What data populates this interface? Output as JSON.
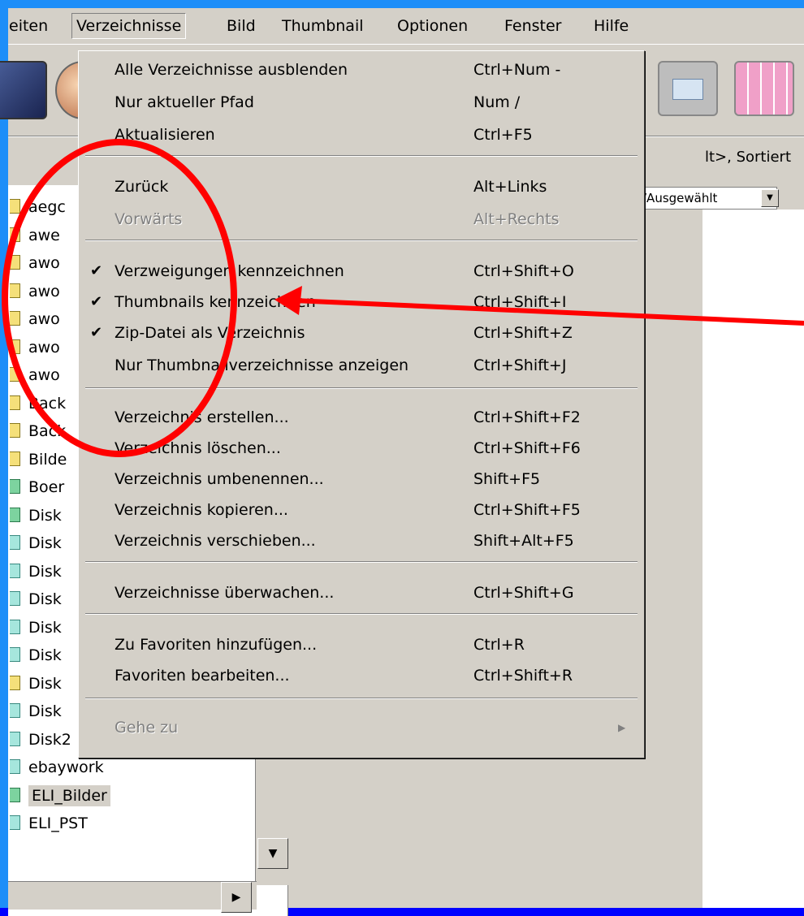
{
  "menubar": {
    "items": [
      "eiten",
      "Verzeichnisse",
      "Bild",
      "Thumbnail",
      "Optionen",
      "Fenster",
      "Hilfe"
    ]
  },
  "infobar": {
    "text": "lt>, Sortiert"
  },
  "combo": {
    "value": "/Ausgewählt"
  },
  "tree": {
    "items": [
      {
        "label": "aegc",
        "color": "yellow"
      },
      {
        "label": "awe",
        "color": "yellow"
      },
      {
        "label": "awo",
        "color": "yellow"
      },
      {
        "label": "awo",
        "color": "yellow"
      },
      {
        "label": "awo",
        "color": "yellow"
      },
      {
        "label": "awo",
        "color": "yellow"
      },
      {
        "label": "awo",
        "color": "yellow"
      },
      {
        "label": "Back",
        "color": "yellow"
      },
      {
        "label": "Back",
        "color": "yellow"
      },
      {
        "label": "Bilde",
        "color": "yellow"
      },
      {
        "label": "Boer",
        "color": "green"
      },
      {
        "label": "Disk",
        "color": "green"
      },
      {
        "label": "Disk",
        "color": "teal"
      },
      {
        "label": "Disk",
        "color": "teal"
      },
      {
        "label": "Disk",
        "color": "teal"
      },
      {
        "label": "Disk",
        "color": "teal"
      },
      {
        "label": "Disk",
        "color": "teal"
      },
      {
        "label": "Disk",
        "color": "yellow"
      },
      {
        "label": "Disk",
        "color": "teal"
      },
      {
        "label": "Disk2",
        "color": "teal"
      },
      {
        "label": "ebaywork",
        "color": "teal"
      },
      {
        "label": "ELI_Bilder",
        "color": "green"
      },
      {
        "label": "ELI_PST",
        "color": "teal"
      }
    ]
  },
  "menu": {
    "items": [
      {
        "label": "Alle Verzeichnisse ausblenden",
        "shortcut": "Ctrl+Num -",
        "checked": "",
        "disabled": false
      },
      {
        "label": "Nur aktueller Pfad",
        "shortcut": "Num /",
        "checked": "",
        "disabled": false
      },
      {
        "label": "Aktualisieren",
        "shortcut": "Ctrl+F5",
        "checked": "",
        "disabled": false
      },
      {
        "label": "Zurück",
        "shortcut": "Alt+Links",
        "checked": "",
        "disabled": false
      },
      {
        "label": "Vorwärts",
        "shortcut": "Alt+Rechts",
        "checked": "",
        "disabled": true
      },
      {
        "label": "Verzweigungen kennzeichnen",
        "shortcut": "Ctrl+Shift+O",
        "checked": "✔",
        "disabled": false
      },
      {
        "label": "Thumbnails kennzeichnen",
        "shortcut": "Ctrl+Shift+I",
        "checked": "✔",
        "disabled": false
      },
      {
        "label": "Zip-Datei als Verzeichnis",
        "shortcut": "Ctrl+Shift+Z",
        "checked": "✔",
        "disabled": false
      },
      {
        "label": "Nur Thumbnailverzeichnisse anzeigen",
        "shortcut": "Ctrl+Shift+J",
        "checked": "",
        "disabled": false
      },
      {
        "label": "Verzeichnis erstellen...",
        "shortcut": "Ctrl+Shift+F2",
        "checked": "",
        "disabled": false
      },
      {
        "label": "Verzeichnis löschen...",
        "shortcut": "Ctrl+Shift+F6",
        "checked": "",
        "disabled": false
      },
      {
        "label": "Verzeichnis umbenennen...",
        "shortcut": "Shift+F5",
        "checked": "",
        "disabled": false
      },
      {
        "label": "Verzeichnis kopieren...",
        "shortcut": "Ctrl+Shift+F5",
        "checked": "",
        "disabled": false
      },
      {
        "label": "Verzeichnis verschieben...",
        "shortcut": "Shift+Alt+F5",
        "checked": "",
        "disabled": false
      },
      {
        "label": "Verzeichnisse überwachen...",
        "shortcut": "Ctrl+Shift+G",
        "checked": "",
        "disabled": false
      },
      {
        "label": "Zu Favoriten hinzufügen...",
        "shortcut": "Ctrl+R",
        "checked": "",
        "disabled": false
      },
      {
        "label": "Favoriten bearbeiten...",
        "shortcut": "Ctrl+Shift+R",
        "checked": "",
        "disabled": false
      },
      {
        "label": "Gehe zu",
        "shortcut": "",
        "checked": "",
        "disabled": true
      }
    ]
  },
  "colors": {
    "annotation": "#ff0000",
    "outer_border": "#1d8ef8",
    "background": "#0000ff"
  },
  "icons": [
    "book-icon",
    "photo-icon",
    "image-icon",
    "grid-icon"
  ]
}
